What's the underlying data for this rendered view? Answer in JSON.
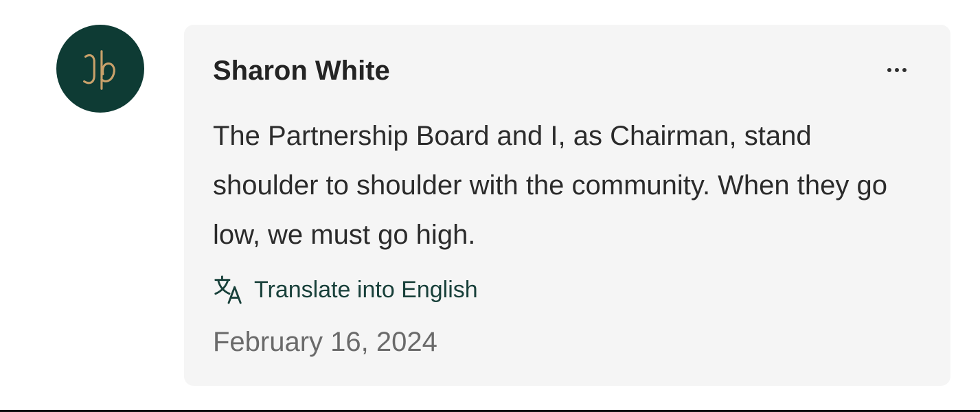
{
  "comment": {
    "author": "Sharon White",
    "text": "The Partnership Board and I, as Chairman, stand shoulder to shoulder with the community. When they go low, we must go high.",
    "date": "February 16, 2024",
    "translate_label": "Translate into English",
    "translate_icon": "translate-icon",
    "more_icon": "more-horizontal-icon"
  },
  "avatar": {
    "monogram": "JLP",
    "background_color": "#0e3b34",
    "monogram_color": "#c9a16a"
  },
  "colors": {
    "card_background": "#f5f5f5",
    "link_color": "#18403a",
    "muted_text": "#6a6a6a"
  }
}
